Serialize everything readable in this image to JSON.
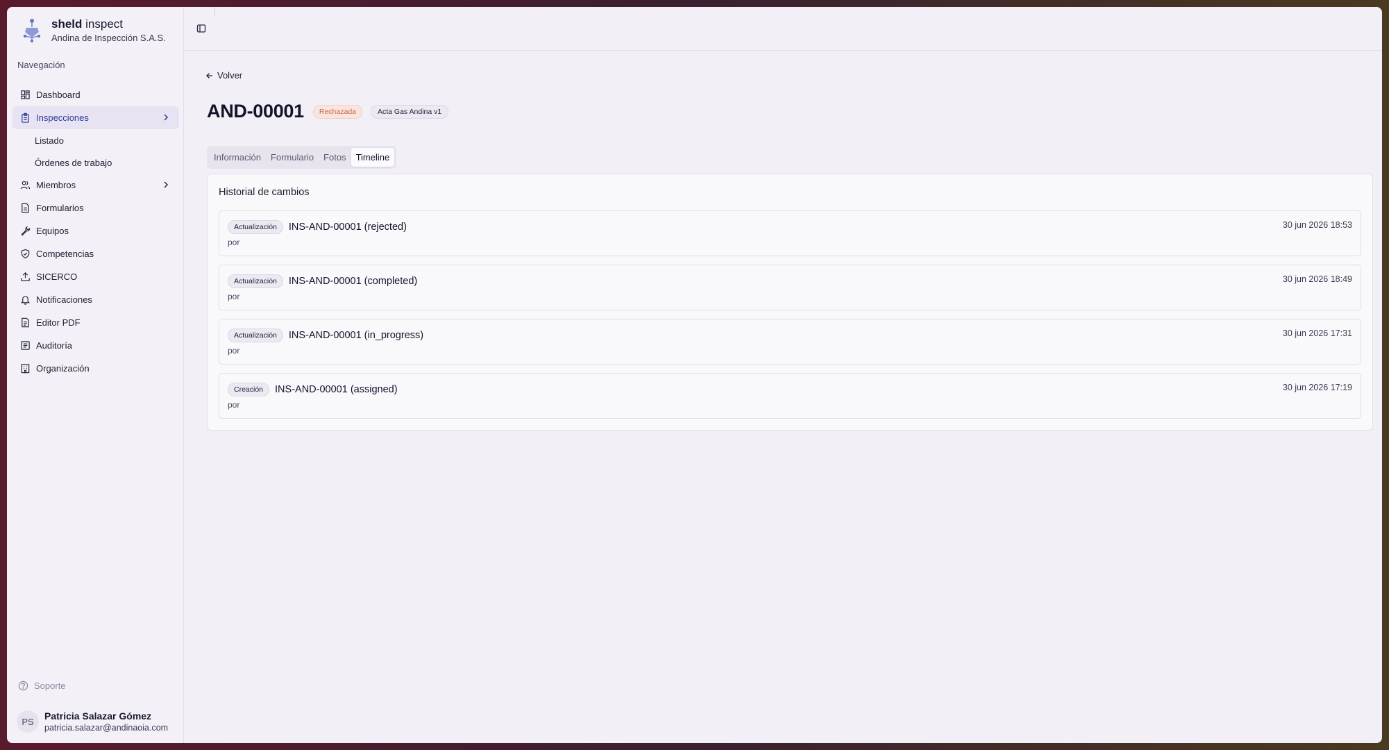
{
  "brand": {
    "name_bold": "sheld",
    "name_light": " inspect",
    "org": "Andina de Inspección S.A.S."
  },
  "nav": {
    "heading": "Navegación",
    "dashboard": "Dashboard",
    "inspecciones": "Inspecciones",
    "listado": "Listado",
    "ordenes": "Órdenes de trabajo",
    "miembros": "Miembros",
    "formularios": "Formularios",
    "equipos": "Equipos",
    "competencias": "Competencias",
    "sicerco": "SICERCO",
    "notificaciones": "Notificaciones",
    "editor_pdf": "Editor PDF",
    "auditoria": "Auditoría",
    "organizacion": "Organización"
  },
  "support": "Soporte",
  "user": {
    "initials": "PS",
    "name": "Patricia Salazar Gómez",
    "email": "patricia.salazar@andinaoia.com"
  },
  "page": {
    "back": "Volver",
    "title": "AND-00001",
    "status": "Rechazada",
    "form": "Acta Gas Andina v1"
  },
  "tabs": [
    "Información",
    "Formulario",
    "Fotos",
    "Timeline"
  ],
  "timeline": {
    "title": "Historial de cambios",
    "entries": [
      {
        "kind": "Actualización",
        "text": "INS-AND-00001 (rejected)",
        "by": "por",
        "date": "30 jun 2026 18:53"
      },
      {
        "kind": "Actualización",
        "text": "INS-AND-00001 (completed)",
        "by": "por",
        "date": "30 jun 2026 18:49"
      },
      {
        "kind": "Actualización",
        "text": "INS-AND-00001 (in_progress)",
        "by": "por",
        "date": "30 jun 2026 17:31"
      },
      {
        "kind": "Creación",
        "text": "INS-AND-00001 (assigned)",
        "by": "por",
        "date": "30 jun 2026 17:19"
      }
    ]
  },
  "colors": {
    "accent": "#2b3a9a",
    "status_rejected": "#c26a3e"
  }
}
